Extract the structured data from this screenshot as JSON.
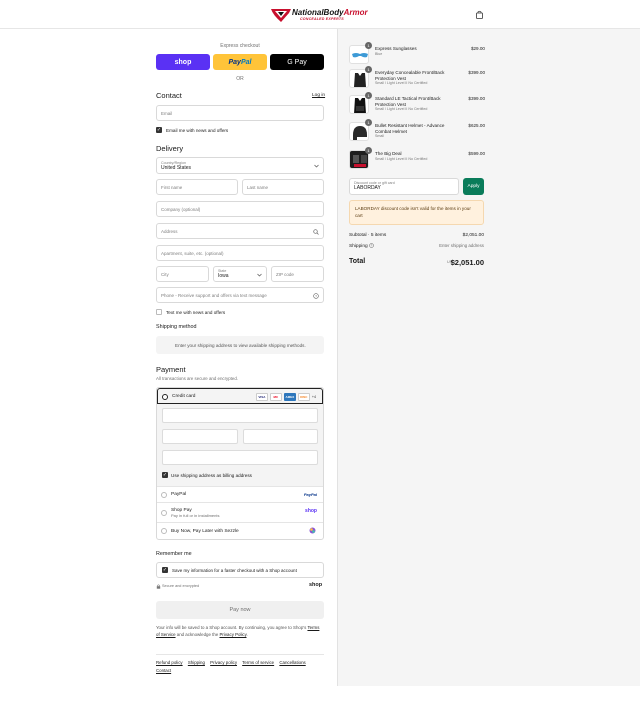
{
  "brand": {
    "name_black": "NationalBody",
    "name_red": "Armor",
    "tagline": "CONCEALED EXPERTS"
  },
  "express": {
    "label": "Express checkout",
    "shop_pay": "shop",
    "paypal_pay": "Pay",
    "paypal_pal": "Pal",
    "gpay": "G Pay",
    "or": "OR"
  },
  "contact": {
    "heading": "Contact",
    "login_link": "Log in",
    "email_placeholder": "Email",
    "news_checkbox": "Email me with news and offers"
  },
  "delivery": {
    "heading": "Delivery",
    "country_label": "Country/Region",
    "country_value": "United States",
    "first_name": "First name",
    "last_name": "Last name",
    "company": "Company (optional)",
    "address": "Address",
    "apartment": "Apartment, suite, etc. (optional)",
    "city": "City",
    "state_label": "State",
    "state_value": "Iowa",
    "zip": "ZIP code",
    "phone": "Phone - Receive support and offers via text message",
    "text_checkbox": "Text me with news and offers"
  },
  "shipping": {
    "heading": "Shipping method",
    "message": "Enter your shipping address to view available shipping methods."
  },
  "payment": {
    "heading": "Payment",
    "subtitle": "All transactions are secure and encrypted.",
    "credit_card": "Credit card",
    "card_badges": [
      "VISA",
      "MC",
      "AMEX",
      "DISC",
      "+4"
    ],
    "billing_checkbox": "Use shipping address as billing address",
    "paypal": "PayPal",
    "paypal_badge": "PayPal",
    "shop_pay": "Shop Pay",
    "shop_pay_sub": "Pay in full or in installments",
    "shop_pay_badge": "shop",
    "sezzle": "Buy Now, Pay Later with Sezzle"
  },
  "remember": {
    "heading": "Remember me",
    "checkbox": "Save my information for a faster checkout with a Shop account",
    "secure": "Secure and encrypted",
    "shop_logo": "shop"
  },
  "pay_now": "Pay now",
  "legal": {
    "prefix": "Your info will be saved to a Shop account. By continuing, you agree to Shop's",
    "terms": "Terms of Service",
    "middle": "and acknowledge the",
    "privacy": "Privacy Policy",
    "suffix": "."
  },
  "footer_links": [
    "Refund policy",
    "Shipping",
    "Privacy policy",
    "Terms of service",
    "Cancellations",
    "Contact"
  ],
  "order": {
    "items": [
      {
        "qty": "1",
        "name": "Express Sunglasses",
        "variant": "Blue",
        "price": "$29.00"
      },
      {
        "qty": "1",
        "name": "Everyday Concealable Front/Back Protection Vest",
        "variant": "Small / Light Level II No Certified",
        "price": "$399.00"
      },
      {
        "qty": "1",
        "name": "Standard LE Tactical Front/Back Protection Vest",
        "variant": "Small / Light Level II No Certified",
        "price": "$399.00"
      },
      {
        "qty": "1",
        "name": "Bullet Resistant Helmet - Advance Combat Helmet",
        "variant": "Small",
        "price": "$625.00"
      },
      {
        "qty": "1",
        "name": "The Big Deal",
        "variant": "Small / Light Level II No Certified",
        "price": "$599.00"
      }
    ],
    "discount_label": "Discount code or gift card",
    "discount_value": "LABORDAY",
    "apply": "Apply",
    "warning": "LABORDAY discount code isn't valid for the items in your cart",
    "subtotal_label": "Subtotal · 5 items",
    "subtotal_value": "$2,051.00",
    "shipping_label": "Shipping",
    "shipping_value": "Enter shipping address",
    "total_label": "Total",
    "currency": "USD",
    "total_value": "$2,051.00"
  },
  "colors": {
    "shop_pay": "#5a31f4",
    "paypal": "#ffc439",
    "apply": "#0a7c5a",
    "brand_red": "#c8102e"
  }
}
